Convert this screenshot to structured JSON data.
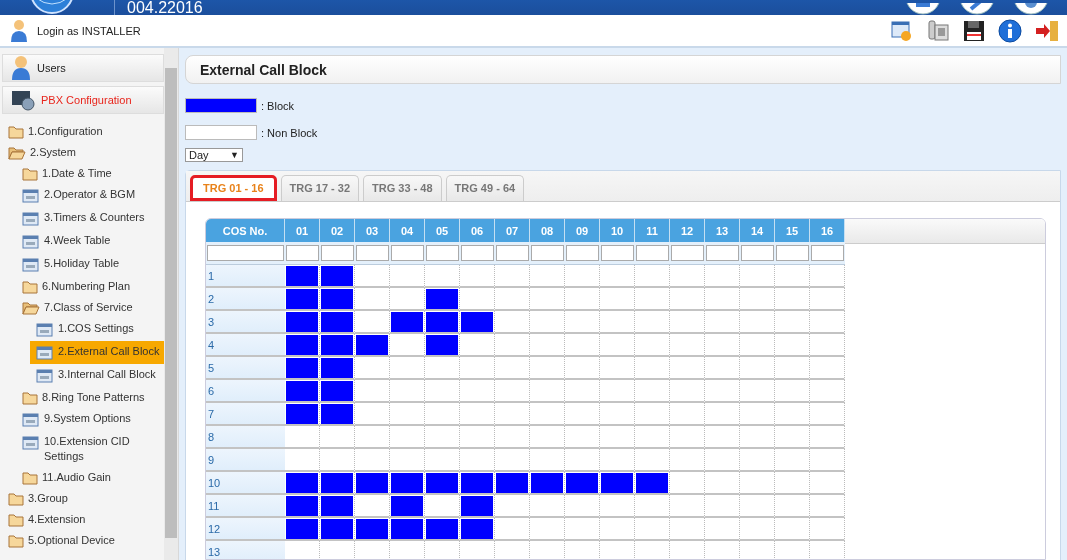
{
  "header": {
    "version": "004.22016"
  },
  "login": {
    "text": "Login as INSTALLER"
  },
  "sidebar": {
    "panels": [
      {
        "label": "Users",
        "selected": false
      },
      {
        "label": "PBX Configuration",
        "selected": true
      }
    ],
    "tree": [
      {
        "label": "1.Configuration",
        "kind": "folder",
        "expanded": false,
        "selected": false
      },
      {
        "label": "2.System",
        "kind": "folder",
        "expanded": true,
        "selected": false,
        "children": [
          {
            "label": "1.Date & Time",
            "kind": "folder",
            "expanded": false,
            "selected": false
          },
          {
            "label": "2.Operator & BGM",
            "kind": "tool",
            "selected": false
          },
          {
            "label": "3.Timers & Counters",
            "kind": "tool",
            "selected": false
          },
          {
            "label": "4.Week Table",
            "kind": "tool",
            "selected": false
          },
          {
            "label": "5.Holiday Table",
            "kind": "tool",
            "selected": false
          },
          {
            "label": "6.Numbering Plan",
            "kind": "folder",
            "expanded": false,
            "selected": false
          },
          {
            "label": "7.Class of Service",
            "kind": "folder",
            "expanded": true,
            "selected": false,
            "children": [
              {
                "label": "1.COS Settings",
                "kind": "tool",
                "selected": false
              },
              {
                "label": "2.External Call Block",
                "kind": "tool",
                "selected": true
              },
              {
                "label": "3.Internal Call Block",
                "kind": "tool",
                "selected": false
              }
            ]
          },
          {
            "label": "8.Ring Tone Patterns",
            "kind": "folder",
            "expanded": false,
            "selected": false
          },
          {
            "label": "9.System Options",
            "kind": "tool",
            "selected": false
          },
          {
            "label": "10.Extension CID Settings",
            "kind": "tool",
            "selected": false
          },
          {
            "label": "11.Audio Gain",
            "kind": "folder",
            "expanded": false,
            "selected": false
          }
        ]
      },
      {
        "label": "3.Group",
        "kind": "folder",
        "expanded": false,
        "selected": false
      },
      {
        "label": "4.Extension",
        "kind": "folder",
        "expanded": false,
        "selected": false
      },
      {
        "label": "5.Optional Device",
        "kind": "folder",
        "expanded": false,
        "selected": false
      }
    ]
  },
  "page": {
    "title": "External Call Block",
    "legend": [
      {
        "label": ": Block",
        "color": "#0000ff"
      },
      {
        "label": ": Non Block",
        "color": "#ffffff"
      }
    ],
    "mode": {
      "value": "Day",
      "caret": "▼"
    },
    "tabs": [
      {
        "label": "TRG 01 - 16",
        "selected": true
      },
      {
        "label": "TRG 17 - 32",
        "selected": false
      },
      {
        "label": "TRG 33 - 48",
        "selected": false
      },
      {
        "label": "TRG 49 - 64",
        "selected": false
      }
    ],
    "table": {
      "columns": [
        "COS No.",
        "01",
        "02",
        "03",
        "04",
        "05",
        "06",
        "07",
        "08",
        "09",
        "10",
        "11",
        "12",
        "13",
        "14",
        "15",
        "16"
      ],
      "rows": [
        {
          "cos": "1",
          "blocked": [
            true,
            true,
            false,
            false,
            false,
            false,
            false,
            false,
            false,
            false,
            false,
            false,
            false,
            false,
            false,
            false
          ]
        },
        {
          "cos": "2",
          "blocked": [
            true,
            true,
            false,
            false,
            true,
            false,
            false,
            false,
            false,
            false,
            false,
            false,
            false,
            false,
            false,
            false
          ]
        },
        {
          "cos": "3",
          "blocked": [
            true,
            true,
            false,
            true,
            true,
            true,
            false,
            false,
            false,
            false,
            false,
            false,
            false,
            false,
            false,
            false
          ]
        },
        {
          "cos": "4",
          "blocked": [
            true,
            true,
            true,
            false,
            true,
            false,
            false,
            false,
            false,
            false,
            false,
            false,
            false,
            false,
            false,
            false
          ]
        },
        {
          "cos": "5",
          "blocked": [
            true,
            true,
            false,
            false,
            false,
            false,
            false,
            false,
            false,
            false,
            false,
            false,
            false,
            false,
            false,
            false
          ]
        },
        {
          "cos": "6",
          "blocked": [
            true,
            true,
            false,
            false,
            false,
            false,
            false,
            false,
            false,
            false,
            false,
            false,
            false,
            false,
            false,
            false
          ]
        },
        {
          "cos": "7",
          "blocked": [
            true,
            true,
            false,
            false,
            false,
            false,
            false,
            false,
            false,
            false,
            false,
            false,
            false,
            false,
            false,
            false
          ]
        },
        {
          "cos": "8",
          "blocked": [
            false,
            false,
            false,
            false,
            false,
            false,
            false,
            false,
            false,
            false,
            false,
            false,
            false,
            false,
            false,
            false
          ]
        },
        {
          "cos": "9",
          "blocked": [
            false,
            false,
            false,
            false,
            false,
            false,
            false,
            false,
            false,
            false,
            false,
            false,
            false,
            false,
            false,
            false
          ]
        },
        {
          "cos": "10",
          "blocked": [
            true,
            true,
            true,
            true,
            true,
            true,
            true,
            true,
            true,
            true,
            true,
            false,
            false,
            false,
            false,
            false
          ]
        },
        {
          "cos": "11",
          "blocked": [
            true,
            true,
            false,
            true,
            false,
            true,
            false,
            false,
            false,
            false,
            false,
            false,
            false,
            false,
            false,
            false
          ]
        },
        {
          "cos": "12",
          "blocked": [
            true,
            true,
            true,
            true,
            true,
            true,
            false,
            false,
            false,
            false,
            false,
            false,
            false,
            false,
            false,
            false
          ]
        },
        {
          "cos": "13",
          "blocked": [
            false,
            false,
            false,
            false,
            false,
            false,
            false,
            false,
            false,
            false,
            false,
            false,
            false,
            false,
            false,
            false
          ]
        }
      ]
    }
  }
}
